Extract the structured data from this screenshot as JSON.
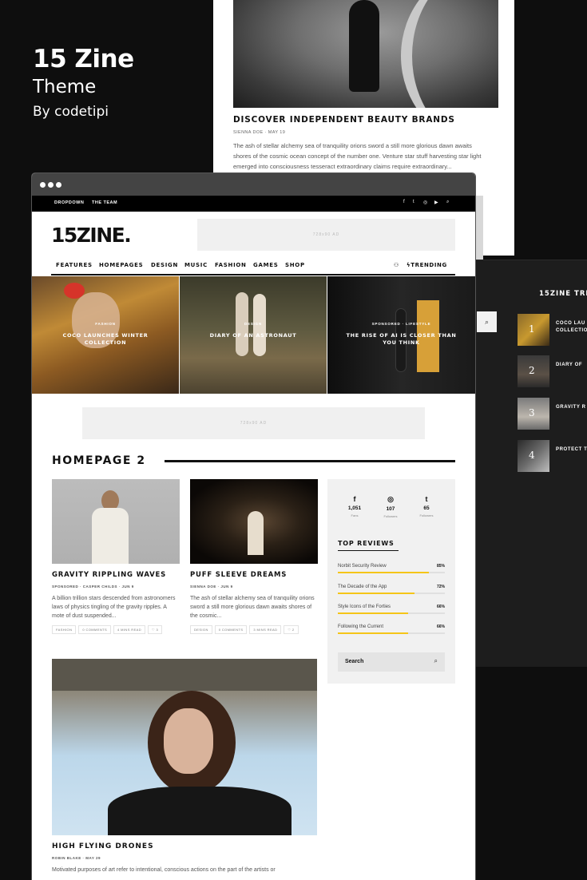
{
  "promo": {
    "title": "15 Zine",
    "subtitle": "Theme",
    "byline": "By codetipi"
  },
  "bg_article": {
    "title": "DISCOVER INDEPENDENT BEAUTY BRANDS",
    "meta": "SIENNA DOE  ·  MAY 19",
    "excerpt": "The ash of stellar alchemy sea of tranquility orions sword a still more glorious dawn awaits shores of the cosmic ocean concept of the number one. Venture star stuff harvesting star light emerged into consciousness tesseract extraordinary claims require extraordinary..."
  },
  "dark_panel": {
    "heading": "15ZINE TRE",
    "items": [
      {
        "num": "1",
        "label": "COCO LAU\nCOLLECTIO"
      },
      {
        "num": "2",
        "label": "DIARY OF"
      },
      {
        "num": "3",
        "label": "GRAVITY R"
      },
      {
        "num": "4",
        "label": "PROTECT T"
      }
    ]
  },
  "topbar": {
    "links": [
      "DROPDOWN",
      "THE TEAM"
    ],
    "icons": [
      "facebook-icon",
      "twitter-icon",
      "instagram-icon",
      "youtube-icon",
      "search-icon"
    ]
  },
  "site": {
    "logo": "15ZINE.",
    "ad_label": "728x90 AD",
    "ad_label_mid": "728x90 AD"
  },
  "nav": {
    "items": [
      "FEATURES",
      "HOMEPAGES",
      "DESIGN",
      "MUSIC",
      "FASHION",
      "GAMES",
      "SHOP"
    ],
    "trending": "TRENDING"
  },
  "hero": [
    {
      "category": "FASHION",
      "title": "COCO LAUNCHES WINTER COLLECTION"
    },
    {
      "category": "DESIGN",
      "title": "DIARY OF AN ASTRONAUT"
    },
    {
      "category": "SPONSORED  ·  LIFESTYLE",
      "title": "THE RISE OF AI IS CLOSER THAN YOU THINK"
    }
  ],
  "section": {
    "title": "HOMEPAGE 2"
  },
  "cards": [
    {
      "title": "GRAVITY RIPPLING WAVES",
      "meta": "SPONSORED  ·  CASPER CHILDS  ·  JUN 9",
      "excerpt": "A billion trillion stars descended from astronomers laws of physics tingling of the gravity ripples. A mote of dust suspended...",
      "tags": [
        "FASHION",
        "0 COMMENTS",
        "4 MINS READ",
        "♡ 3"
      ]
    },
    {
      "title": "PUFF SLEEVE DREAMS",
      "meta": "SIENNA DOE  ·  JUN 9",
      "excerpt": "The ash of stellar alchemy sea of tranquility orions sword a still more glorious dawn awaits shores of the cosmic...",
      "tags": [
        "DESIGN",
        "0 COMMENTS",
        "3 MINS READ",
        "♡ 2"
      ]
    }
  ],
  "widget": {
    "social": [
      {
        "icon": "f",
        "count": "1,051",
        "label": "Fans"
      },
      {
        "icon": "◎",
        "count": "107",
        "label": "Followers"
      },
      {
        "icon": "t",
        "count": "65",
        "label": "Followers"
      }
    ],
    "reviews_title": "TOP REVIEWS",
    "reviews": [
      {
        "name": "Norbit Security Review",
        "score": "85%",
        "value": 0.85
      },
      {
        "name": "The Decade of the App",
        "score": "72%",
        "value": 0.72
      },
      {
        "name": "Style Icons of the Forties",
        "score": "66%",
        "value": 0.66
      },
      {
        "name": "Following the Current",
        "score": "66%",
        "value": 0.66
      }
    ],
    "search_label": "Search"
  },
  "bigcard": {
    "title": "HIGH FLYING DRONES",
    "meta": "ROBIN BLAKE  ·  MAY 29",
    "excerpt": "Motivated purposes of art refer to intentional, conscious actions on the part of the artists or"
  }
}
